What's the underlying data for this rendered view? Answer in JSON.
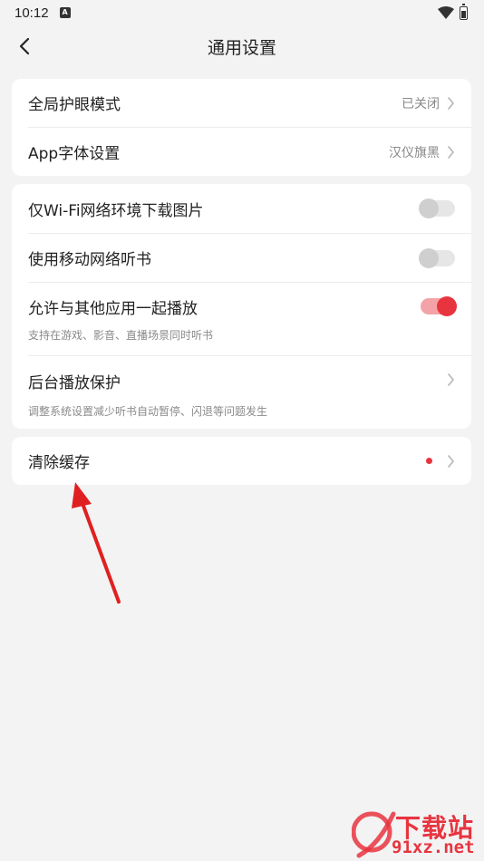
{
  "status_bar": {
    "time": "10:12",
    "notification_badge": "A",
    "icons": [
      "wifi-icon",
      "battery-icon"
    ]
  },
  "header": {
    "title": "通用设置",
    "back_icon": "chevron-left-icon"
  },
  "display_section": {
    "eye_protection": {
      "label": "全局护眼模式",
      "value": "已关闭"
    },
    "app_font": {
      "label": "App字体设置",
      "value": "汉仪旗黑"
    }
  },
  "playback_section": {
    "wifi_only_images": {
      "label": "仅Wi-Fi网络环境下载图片",
      "enabled": false
    },
    "mobile_listening": {
      "label": "使用移动网络听书",
      "enabled": false
    },
    "mix_playback": {
      "label": "允许与其他应用一起播放",
      "subtitle": "支持在游戏、影音、直播场景同时听书",
      "enabled": true
    },
    "background_protection": {
      "label": "后台播放保护",
      "subtitle": "调整系统设置减少听书自动暂停、闪退等问题发生"
    }
  },
  "cache_section": {
    "clear_cache": {
      "label": "清除缓存",
      "has_red_dot": true
    }
  },
  "annotation": {
    "arrow_color": "#e02020"
  },
  "watermark": {
    "brand": "下载站",
    "domain": "91xz.net",
    "logo_text": "91"
  },
  "colors": {
    "accent": "#e8343f",
    "toggle_on_track": "#f3a3a8",
    "background": "#f3f3f3"
  }
}
